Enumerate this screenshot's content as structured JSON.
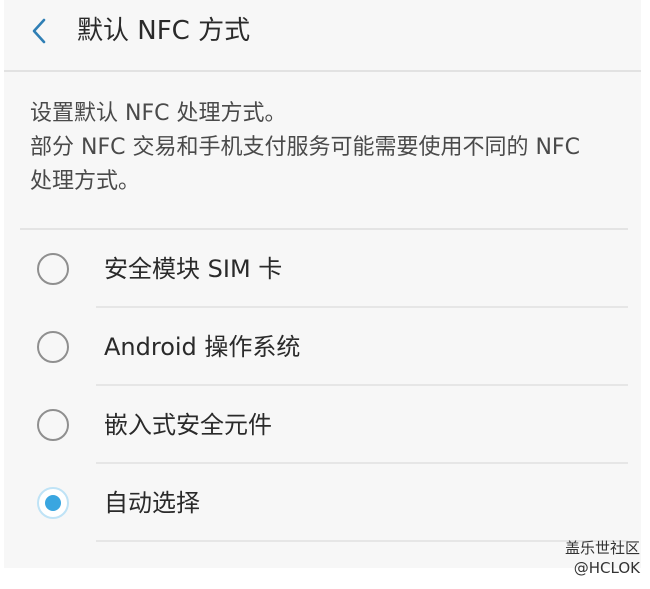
{
  "header": {
    "title": "默认 NFC 方式"
  },
  "description": {
    "line1": "设置默认 NFC 处理方式。",
    "line2": "部分 NFC 交易和手机支付服务可能需要使用不同的 NFC",
    "line3": "处理方式。"
  },
  "options": [
    {
      "label": "安全模块 SIM 卡",
      "checked": false
    },
    {
      "label": "Android 操作系统",
      "checked": false
    },
    {
      "label": "嵌入式安全元件",
      "checked": false
    },
    {
      "label": "自动选择",
      "checked": true
    }
  ],
  "watermark": {
    "line1": "盖乐世社区",
    "line2": "@HCLOK"
  },
  "colors": {
    "accent": "#3aa6e0",
    "background": "#f7f7f7"
  }
}
